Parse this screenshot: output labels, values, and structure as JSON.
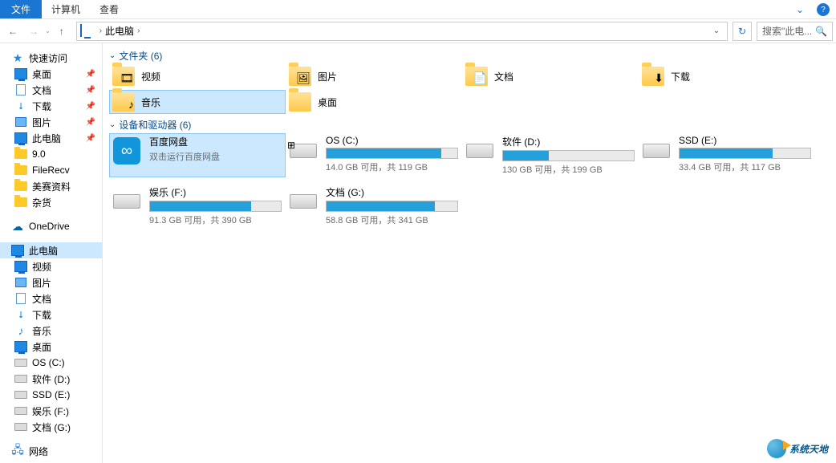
{
  "menubar": {
    "file": "文件",
    "computer": "计算机",
    "view": "查看"
  },
  "nav": {
    "location": "此电脑",
    "search_placeholder": "搜索\"此电...",
    "refresh": "↻"
  },
  "sidebar": {
    "quick": "快速访问",
    "quick_items": [
      {
        "label": "桌面",
        "icon": "monitor",
        "pinned": true
      },
      {
        "label": "文档",
        "icon": "doc",
        "pinned": true
      },
      {
        "label": "下载",
        "icon": "down",
        "pinned": true
      },
      {
        "label": "图片",
        "icon": "pic",
        "pinned": true
      },
      {
        "label": "此电脑",
        "icon": "monitor",
        "pinned": true
      },
      {
        "label": "9.0",
        "icon": "folder",
        "pinned": false
      },
      {
        "label": "FileRecv",
        "icon": "folder",
        "pinned": false
      },
      {
        "label": "美赛资料",
        "icon": "folder",
        "pinned": false
      },
      {
        "label": "杂货",
        "icon": "folder",
        "pinned": false
      }
    ],
    "onedrive": "OneDrive",
    "thispc": "此电脑",
    "thispc_items": [
      {
        "label": "视频",
        "icon": "monitor"
      },
      {
        "label": "图片",
        "icon": "pic"
      },
      {
        "label": "文档",
        "icon": "doc"
      },
      {
        "label": "下载",
        "icon": "down"
      },
      {
        "label": "音乐",
        "icon": "note"
      },
      {
        "label": "桌面",
        "icon": "monitor"
      },
      {
        "label": "OS (C:)",
        "icon": "drive"
      },
      {
        "label": "软件 (D:)",
        "icon": "drive"
      },
      {
        "label": "SSD (E:)",
        "icon": "drive"
      },
      {
        "label": "娱乐 (F:)",
        "icon": "drive"
      },
      {
        "label": "文档 (G:)",
        "icon": "drive"
      }
    ],
    "network": "网络"
  },
  "groups": {
    "folders_header": "文件夹 (6)",
    "drives_header": "设备和驱动器 (6)"
  },
  "folders": [
    {
      "name": "视频",
      "overlay": "🎞"
    },
    {
      "name": "图片",
      "overlay": "🖼"
    },
    {
      "name": "文档",
      "overlay": "📄"
    },
    {
      "name": "下载",
      "overlay": "⬇"
    },
    {
      "name": "音乐",
      "overlay": "♪",
      "selected": true
    },
    {
      "name": "桌面",
      "overlay": ""
    }
  ],
  "drives": [
    {
      "name": "百度网盘",
      "sub": "双击运行百度网盘",
      "type": "cloud",
      "selected": true
    },
    {
      "name": "OS (C:)",
      "info": "14.0 GB 可用，共 119 GB",
      "fill": 88,
      "badge": "⊞"
    },
    {
      "name": "软件 (D:)",
      "info": "130 GB 可用，共 199 GB",
      "fill": 35
    },
    {
      "name": "SSD (E:)",
      "info": "33.4 GB 可用，共 117 GB",
      "fill": 71
    },
    {
      "name": "娱乐 (F:)",
      "info": "91.3 GB 可用，共 390 GB",
      "fill": 77
    },
    {
      "name": "文档 (G:)",
      "info": "58.8 GB 可用，共 341 GB",
      "fill": 83
    }
  ],
  "watermark": "系统天地"
}
